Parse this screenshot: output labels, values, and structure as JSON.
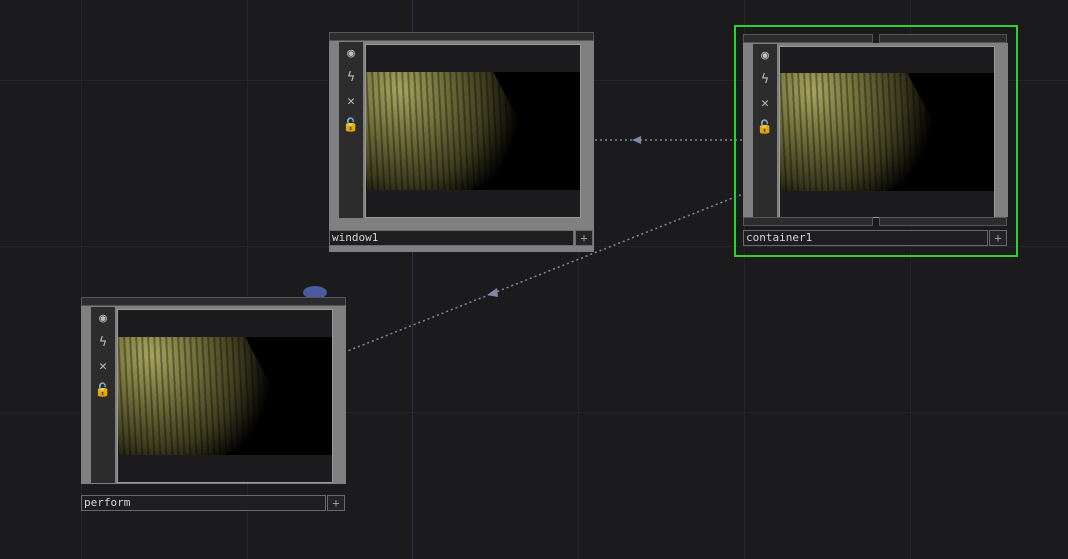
{
  "nodes": {
    "window1": {
      "name": "window1",
      "plus": "+"
    },
    "container1": {
      "name": "container1",
      "plus": "+"
    },
    "perform": {
      "name": "perform",
      "plus": "+"
    }
  },
  "icons": {
    "viewer": "◉",
    "bypass": "ϟ",
    "delete": "✕",
    "lock": "🔓"
  },
  "colors": {
    "background": "#1b1b1e",
    "selection": "#2fd12f",
    "wire": "#7e8aa0",
    "comment": "#4b5ba0"
  }
}
